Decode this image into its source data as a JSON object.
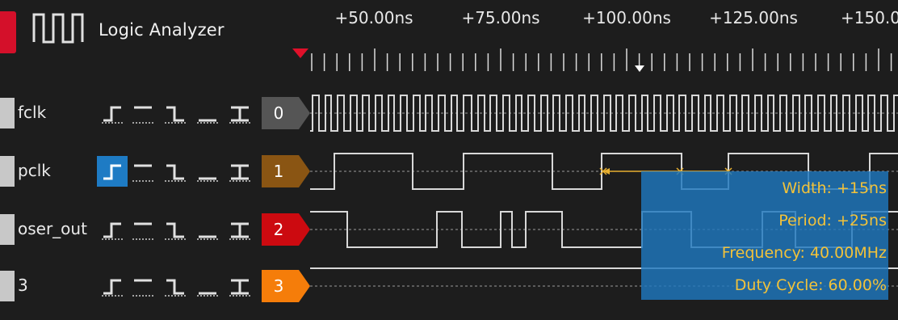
{
  "app": {
    "title": "Logic Analyzer",
    "logo_icon": "waveform-logo-icon",
    "accent_color": "#d4102a"
  },
  "time_ruler": {
    "labels": [
      "+50.00ns",
      "+75.00ns",
      "+100.00ns",
      "+125.00ns",
      "+150.0"
    ]
  },
  "trigger_buttons": [
    "rising-edge",
    "high-level",
    "falling-edge",
    "low-level",
    "any-edge"
  ],
  "channels": [
    {
      "name": "fclk",
      "number": "0",
      "color": "#555555",
      "active_trigger": null
    },
    {
      "name": "pclk",
      "number": "1",
      "color": "#8a5513",
      "active_trigger": "rising-edge"
    },
    {
      "name": "oser_out",
      "number": "2",
      "color": "#cc0a10",
      "active_trigger": null
    },
    {
      "name": "3",
      "number": "3",
      "color": "#f57d0a",
      "active_trigger": null
    }
  ],
  "measurements": {
    "width": "Width: +15ns",
    "period": "Period: +25ns",
    "frequency": "Frequency: 40.00MHz",
    "duty_cycle": "Duty Cycle: 60.00%"
  },
  "colors": {
    "background": "#1d1d1d",
    "waveform": "#d8d8d8",
    "measure_panel": "#1e78be",
    "measure_text": "#f2c23a",
    "cursor": "#e8b030"
  }
}
